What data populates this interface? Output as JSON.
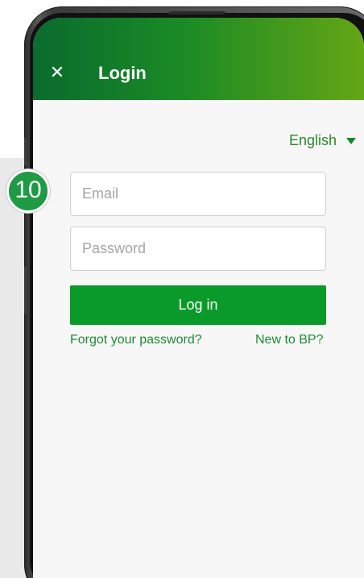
{
  "step_badge": "10",
  "header": {
    "close_icon": "close-icon",
    "title": "Login"
  },
  "language": {
    "selected": "English",
    "icon": "caret-down-icon"
  },
  "form": {
    "email_placeholder": "Email",
    "password_placeholder": "Password",
    "login_label": "Log in"
  },
  "links": {
    "forgot": "Forgot your password?",
    "new_to": "New to BP?"
  },
  "colors": {
    "header_start": "#0a6b2e",
    "header_end": "#64a615",
    "primary": "#0a9a2a",
    "link": "#1e8a35",
    "badge": "#1f9a45"
  }
}
